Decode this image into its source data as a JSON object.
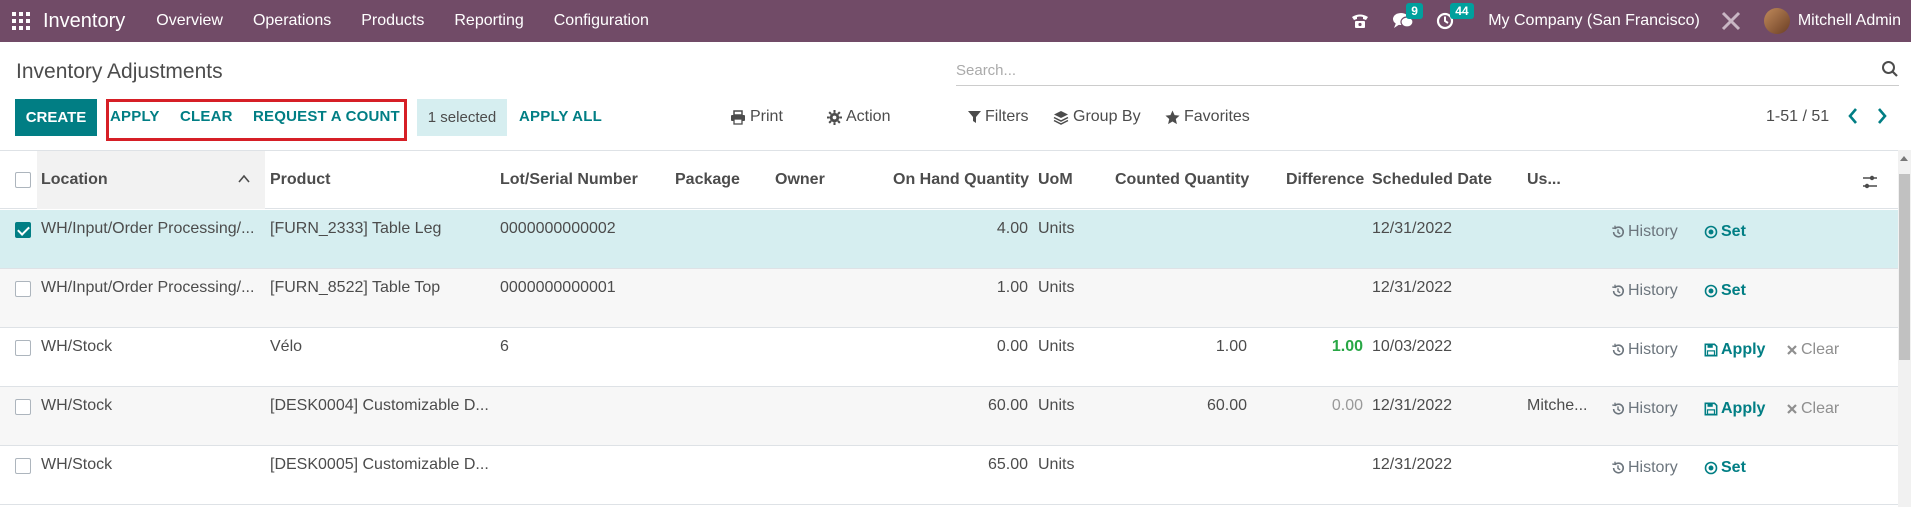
{
  "app": {
    "name": "Inventory",
    "menu": [
      "Overview",
      "Operations",
      "Products",
      "Reporting",
      "Configuration"
    ]
  },
  "navbar": {
    "messages_count": "9",
    "activities_count": "44",
    "company": "My Company (San Francisco)",
    "user": "Mitchell Admin"
  },
  "page": {
    "title": "Inventory Adjustments",
    "search_placeholder": "Search..."
  },
  "toolbar": {
    "create": "CREATE",
    "apply": "APPLY",
    "clear": "CLEAR",
    "request_count": "REQUEST A COUNT",
    "selected": "1 selected",
    "apply_all": "APPLY ALL",
    "print": "Print",
    "action": "Action",
    "filters": "Filters",
    "group_by": "Group By",
    "favorites": "Favorites",
    "pager": "1-51 / 51"
  },
  "table": {
    "columns": {
      "location": "Location",
      "product": "Product",
      "lot": "Lot/Serial Number",
      "package": "Package",
      "owner": "Owner",
      "on_hand": "On Hand Quantity",
      "uom": "UoM",
      "counted": "Counted Quantity",
      "difference": "Difference",
      "scheduled": "Scheduled Date",
      "user": "Us..."
    },
    "rows": [
      {
        "location": "WH/Input/Order Processing/...",
        "product": "[FURN_2333] Table Leg",
        "lot": "0000000000002",
        "on_hand": "4.00",
        "uom": "Units",
        "counted": "",
        "difference": "",
        "scheduled": "12/31/2022",
        "user": "",
        "history": "History",
        "set": "Set"
      },
      {
        "location": "WH/Input/Order Processing/...",
        "product": "[FURN_8522] Table Top",
        "lot": "0000000000001",
        "on_hand": "1.00",
        "uom": "Units",
        "counted": "",
        "difference": "",
        "scheduled": "12/31/2022",
        "user": "",
        "history": "History",
        "set": "Set"
      },
      {
        "location": "WH/Stock",
        "product": "Vélo",
        "lot": "6",
        "on_hand": "0.00",
        "uom": "Units",
        "counted": "1.00",
        "difference": "1.00",
        "scheduled": "10/03/2022",
        "user": "",
        "history": "History",
        "apply": "Apply",
        "clear": "Clear"
      },
      {
        "location": "WH/Stock",
        "product": "[DESK0004] Customizable D...",
        "lot": "",
        "on_hand": "60.00",
        "uom": "Units",
        "counted": "60.00",
        "difference": "0.00",
        "scheduled": "12/31/2022",
        "user": "Mitche...",
        "history": "History",
        "apply": "Apply",
        "clear": "Clear"
      },
      {
        "location": "WH/Stock",
        "product": "[DESK0005] Customizable D...",
        "lot": "",
        "on_hand": "65.00",
        "uom": "Units",
        "counted": "",
        "difference": "",
        "scheduled": "12/31/2022",
        "user": "",
        "history": "History",
        "set": "Set"
      }
    ]
  }
}
